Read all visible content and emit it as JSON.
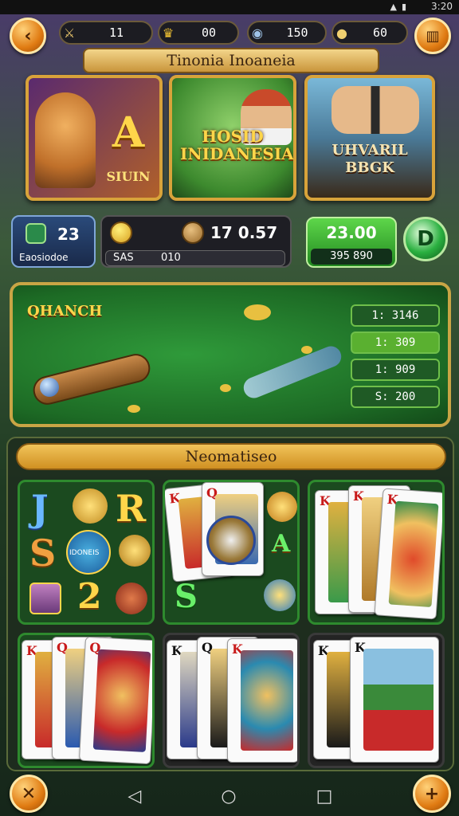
{
  "status": {
    "time": "3:20"
  },
  "header": {
    "resources": [
      {
        "icon": "dagger-icon",
        "value": "11"
      },
      {
        "icon": "trophy-icon",
        "value": "00"
      },
      {
        "icon": "coin-stack-icon",
        "value": "150"
      },
      {
        "icon": "gold-coin-icon",
        "value": "60"
      }
    ],
    "banner_title": "Tinonia Inoaneia"
  },
  "games": [
    {
      "title": "SIUIN",
      "letter": "A"
    },
    {
      "title": "HOSID INIDANESIA"
    },
    {
      "title": "UHVARIL BBGK"
    }
  ],
  "stats": {
    "level_value": "23",
    "level_label": "Eaosiodoe",
    "balance_a": "17 0.57",
    "sub_a": "SAS",
    "sub_b": "010",
    "green_value": "23.00",
    "green_sub": "395 890",
    "round_button_letter": "D"
  },
  "table": {
    "title": "QHANCH",
    "odds": [
      "1: 3146",
      "1: 309",
      "1: 909",
      "S: 200"
    ]
  },
  "section": {
    "title": "Neomatiseo",
    "slot_symbols": [
      "J",
      "R",
      "S",
      "2"
    ],
    "slot_badge": "IDONEIS"
  },
  "cards": {
    "row2_ranks": [
      "K",
      "Q",
      "K",
      "Q",
      "K",
      "Q"
    ]
  },
  "colors": {
    "accent": "#e07b12",
    "felt": "#2f9a3a",
    "gold": "#d8a33a"
  }
}
